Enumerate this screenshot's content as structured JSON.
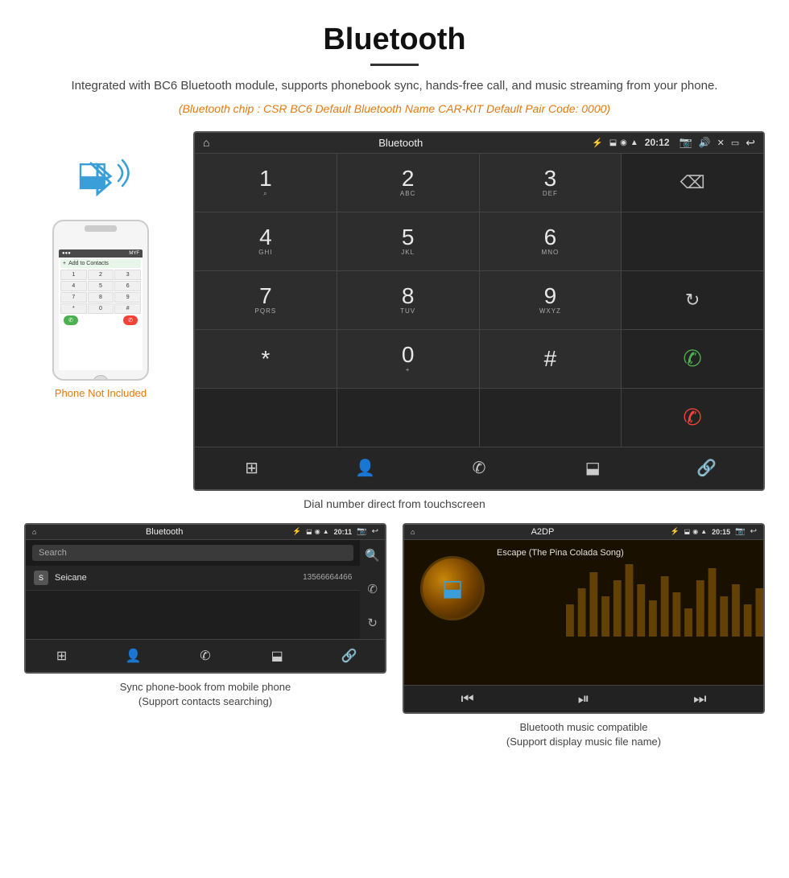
{
  "header": {
    "title": "Bluetooth",
    "subtitle": "Integrated with BC6 Bluetooth module, supports phonebook sync, hands-free call, and music streaming from your phone.",
    "specs": "(Bluetooth chip : CSR BC6    Default Bluetooth Name CAR-KIT    Default Pair Code: 0000)"
  },
  "phone_section": {
    "not_included_label": "Phone Not Included"
  },
  "car_screen": {
    "status_bar": {
      "title": "Bluetooth",
      "time": "20:12"
    },
    "dialpad": [
      {
        "main": "1",
        "sub": "⌁"
      },
      {
        "main": "2",
        "sub": "ABC"
      },
      {
        "main": "3",
        "sub": "DEF"
      },
      {
        "main": "⌫",
        "sub": "",
        "type": "backspace"
      },
      {
        "main": "4",
        "sub": "GHI"
      },
      {
        "main": "5",
        "sub": "JKL"
      },
      {
        "main": "6",
        "sub": "MNO"
      },
      {
        "main": "",
        "sub": "",
        "type": "empty"
      },
      {
        "main": "7",
        "sub": "PQRS"
      },
      {
        "main": "8",
        "sub": "TUV"
      },
      {
        "main": "9",
        "sub": "WXYZ"
      },
      {
        "main": "↻",
        "sub": "",
        "type": "reload"
      },
      {
        "main": "*",
        "sub": ""
      },
      {
        "main": "0",
        "sub": "+"
      },
      {
        "main": "#",
        "sub": ""
      },
      {
        "main": "✆",
        "sub": "",
        "type": "call-green"
      },
      {
        "main": "✆",
        "sub": "",
        "type": "call-red"
      }
    ]
  },
  "dial_caption": "Dial number direct from touchscreen",
  "phonebook_screen": {
    "status_bar": {
      "title": "Bluetooth",
      "time": "20:11"
    },
    "search_placeholder": "Search",
    "contacts": [
      {
        "letter": "S",
        "name": "Seicane",
        "number": "13566664466"
      }
    ]
  },
  "phonebook_caption": "Sync phone-book from mobile phone\n(Support contacts searching)",
  "music_screen": {
    "status_bar": {
      "title": "A2DP",
      "time": "20:15"
    },
    "song_title": "Escape (The Pina Colada Song)"
  },
  "music_caption": "Bluetooth music compatible\n(Support display music file name)"
}
